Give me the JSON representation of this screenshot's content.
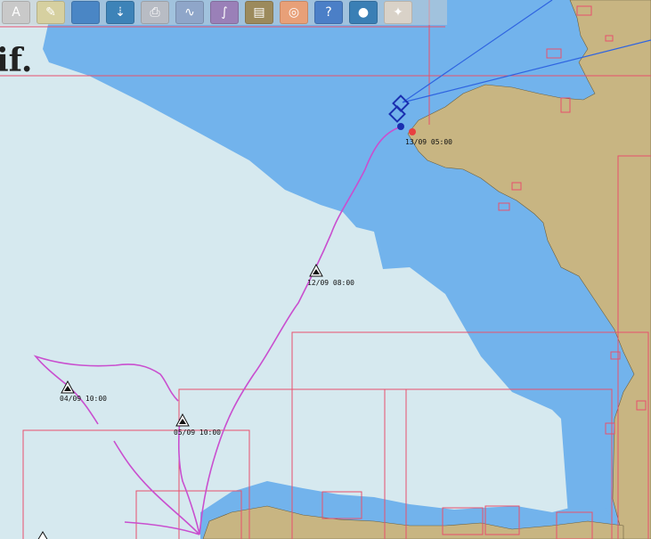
{
  "toolbar": {
    "buttons": [
      {
        "name": "route-text-tool",
        "glyph": "A",
        "color": "#c9c9c9"
      },
      {
        "name": "route-draw-tool",
        "glyph": "✎",
        "color": "#d6d0a0"
      },
      {
        "name": "sea-layer-tool",
        "glyph": "",
        "color": "#4a86c5"
      },
      {
        "name": "depth-layer-tool",
        "glyph": "⇣",
        "color": "#3d83b8"
      },
      {
        "name": "print-tool",
        "glyph": "⎙",
        "color": "#b8bcc4"
      },
      {
        "name": "chart-graph-tool",
        "glyph": "∿",
        "color": "#8fa6c9"
      },
      {
        "name": "track-tool",
        "glyph": "∫",
        "color": "#9a80b8"
      },
      {
        "name": "layers-tool",
        "glyph": "▤",
        "color": "#9c8a5c"
      },
      {
        "name": "lifebuoy-tool",
        "glyph": "◎",
        "color": "#e8a078"
      },
      {
        "name": "help-tool",
        "glyph": "?",
        "color": "#4b7fc7"
      },
      {
        "name": "globe-tool",
        "glyph": "●",
        "color": "#3a7fb5"
      },
      {
        "name": "compass-tool",
        "glyph": "✦",
        "color": "#d9d2c8"
      }
    ]
  },
  "map": {
    "partial_title": "if.",
    "waypoints": [
      {
        "label": "13/09 05:00"
      },
      {
        "label": "12/09 08:00"
      },
      {
        "label": "04/09 10:00"
      },
      {
        "label": "05/09 10:00"
      }
    ],
    "colors": {
      "open_sea": "#d6e9ef",
      "shallow_sea": "#72b3ec",
      "land": "#c8b582",
      "track": "#c94fcf",
      "chart_bounds": "#e8506c",
      "route_line": "#2f64e0"
    }
  }
}
